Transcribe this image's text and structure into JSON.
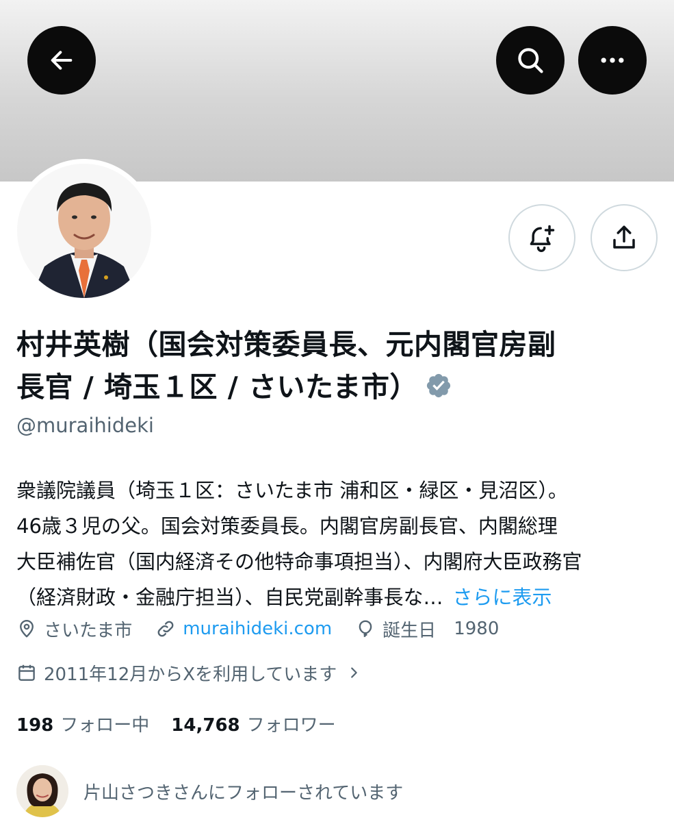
{
  "header": {
    "back_icon": "arrow-left-icon",
    "search_icon": "search-icon",
    "more_icon": "more-horizontal-icon"
  },
  "profile": {
    "name_line1": "村井英樹（国会対策委員長、元内閣官房副",
    "name_line2": "長官 / 埼玉１区 / さいたま市）",
    "verified_icon": "verified-badge-icon",
    "handle": "@muraihideki",
    "bio": [
      "衆議院議員（埼玉１区：さいたま市 浦和区・緑区・見沼区）。",
      "46歳３児の父。国会対策委員長。内閣官房副長官、内閣総理",
      "大臣補佐官（国内経済その他特命事項担当）、内閣府大臣政務官",
      "（経済財政・金融庁担当）、自民党副幹事長な…"
    ],
    "more_label": "さらに表示",
    "location": "さいたま市",
    "website": "muraihideki.com",
    "birth_label": "誕生日",
    "birth_year": "1980",
    "joined": "2011年12月からXを利用しています"
  },
  "stats": {
    "following_count": "198",
    "following_label": "フォロー中",
    "followers_count": "14,768",
    "followers_label": "フォロワー"
  },
  "followed_by": {
    "text": "片山さつきさんにフォローされています"
  },
  "colors": {
    "accent": "#1d9bf0",
    "text": "#0f1419",
    "secondary": "#536471",
    "verified": "#829aab"
  }
}
